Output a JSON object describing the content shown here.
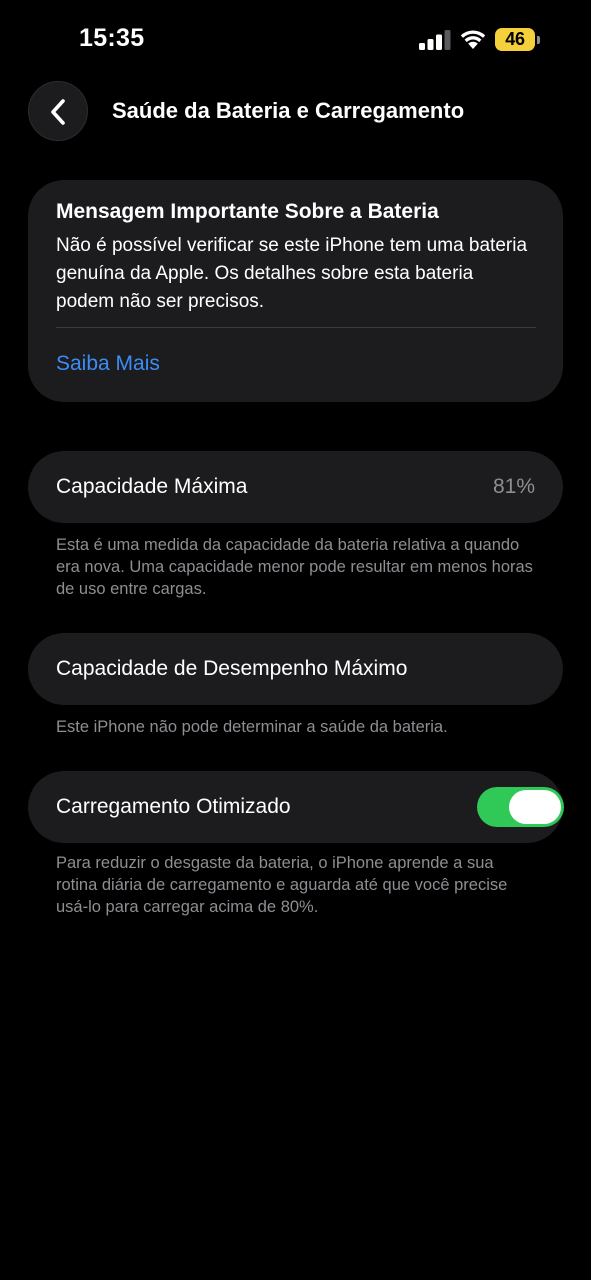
{
  "status_bar": {
    "time": "15:35",
    "battery_level": "46",
    "signal_icon": "cellular-signal-icon",
    "wifi_icon": "wifi-icon",
    "battery_color": "#f4d03a"
  },
  "nav": {
    "back_icon": "chevron-left-icon",
    "title": "Saúde da Bateria e Carregamento"
  },
  "notice": {
    "title": "Mensagem Importante Sobre a Bateria",
    "body": "Não é possível verificar se este iPhone tem uma bateria genuína da Apple. Os detalhes sobre esta bateria podem não ser precisos.",
    "link": "Saiba Mais",
    "link_color": "#3b8cf5"
  },
  "max_capacity": {
    "label": "Capacidade Máxima",
    "value": "81%",
    "footnote": "Esta é uma medida da capacidade da bateria relativa a quando era nova. Uma capacidade menor pode resultar em menos horas de uso entre cargas."
  },
  "peak_performance": {
    "label": "Capacidade de Desempenho Máximo",
    "footnote": "Este iPhone não pode determinar a saúde da bateria."
  },
  "optimized_charging": {
    "label": "Carregamento Otimizado",
    "enabled": true,
    "toggle_color": "#30c857",
    "footnote": "Para reduzir o desgaste da bateria, o iPhone aprende a sua rotina diária de carregamento e aguarda até que você precise usá-lo para carregar acima de 80%."
  }
}
